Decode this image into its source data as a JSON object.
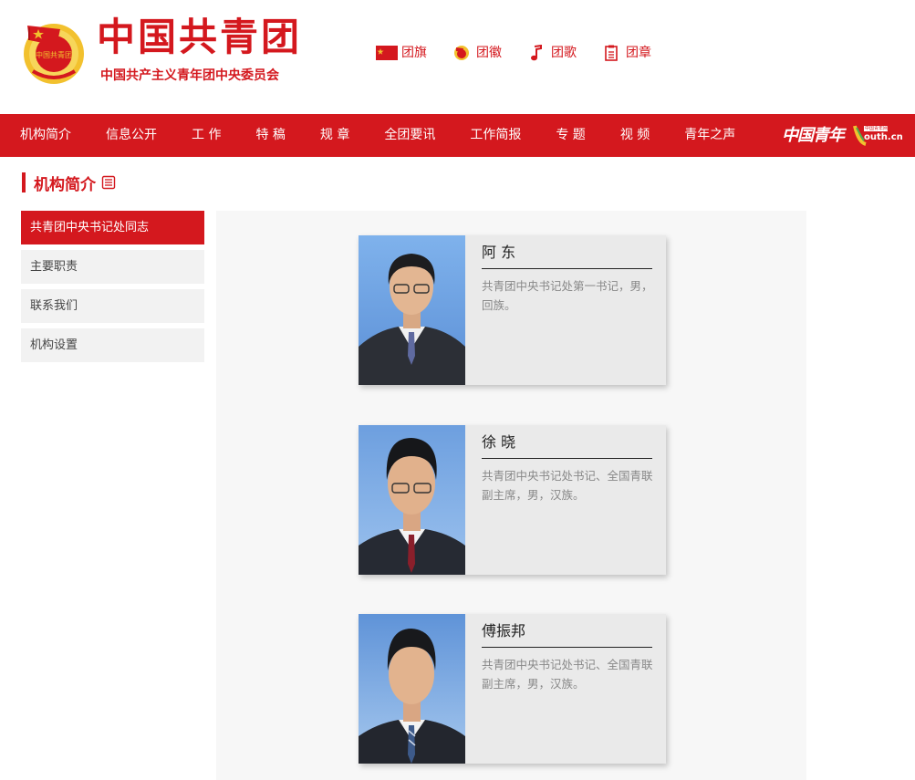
{
  "header": {
    "title": "中国共青团",
    "subtitle": "中国共产主义青年团中央委员会",
    "emblem_text": "中国共青团",
    "symbols": [
      {
        "label": "团旗",
        "icon": "flag-icon"
      },
      {
        "label": "团徽",
        "icon": "emblem-icon"
      },
      {
        "label": "团歌",
        "icon": "music-note-icon"
      },
      {
        "label": "团章",
        "icon": "document-icon"
      }
    ]
  },
  "nav": {
    "items": [
      "机构简介",
      "信息公开",
      "工 作",
      "特 稿",
      "规 章",
      "全团要讯",
      "工作简报",
      "专 题",
      "视 频",
      "青年之声"
    ],
    "brand_cn": "中国青年",
    "brand_youth": "outh.cn",
    "brand_youth_tag": "中国青年网"
  },
  "section": {
    "title": "机构简介"
  },
  "sidebar": {
    "items": [
      {
        "label": "共青团中央书记处同志",
        "active": true
      },
      {
        "label": "主要职责",
        "active": false
      },
      {
        "label": "联系我们",
        "active": false
      },
      {
        "label": "机构设置",
        "active": false
      }
    ]
  },
  "cards": [
    {
      "name": "阿 东",
      "description": "共青团中央书记处第一书记，男，回族。"
    },
    {
      "name": "徐 晓",
      "description": "共青团中央书记处书记、全国青联副主席，男，汉族。"
    },
    {
      "name": "傅振邦",
      "description": "共青团中央书记处书记、全国青联副主席，男，汉族。"
    }
  ],
  "colors": {
    "brand_red": "#d4181e",
    "emblem_gold": "#f2c12e",
    "photo_sky": "#6fa3e0"
  }
}
